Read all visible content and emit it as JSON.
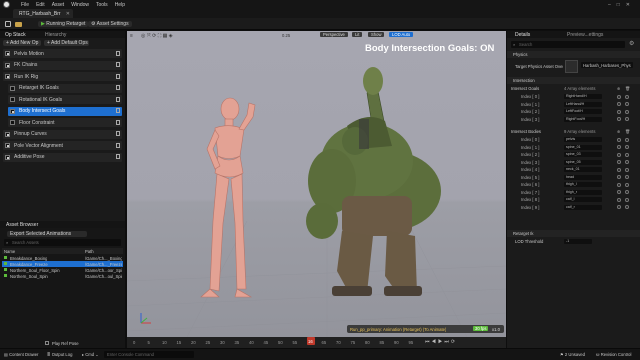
{
  "app": {
    "menu": [
      "File",
      "Edit",
      "Asset",
      "Window",
      "Tools",
      "Help"
    ],
    "tab_title": "RTG_Harbash_Brr",
    "toolbar": {
      "run_retarget": "Running Retarget",
      "asset_settings": "Asset Settings"
    }
  },
  "left": {
    "tabs": [
      "Op Stack",
      "Hierarchy"
    ],
    "add_new_op": "+ Add New Op",
    "add_default_ops": "+ Add Default Ops",
    "ops": [
      {
        "label": "Pelvis Motion",
        "checked": true,
        "sub": false,
        "selected": false
      },
      {
        "label": "FK Chains",
        "checked": true,
        "sub": false,
        "selected": false
      },
      {
        "label": "Run IK Rig",
        "checked": true,
        "sub": false,
        "selected": false
      },
      {
        "label": "Retarget IK Goals",
        "checked": false,
        "sub": true,
        "selected": false
      },
      {
        "label": "Rotational IK Goals",
        "checked": false,
        "sub": true,
        "selected": false
      },
      {
        "label": "Body Intersect Goals",
        "checked": true,
        "sub": true,
        "selected": true
      },
      {
        "label": "Floor Constraint",
        "checked": false,
        "sub": true,
        "selected": false
      },
      {
        "label": "Pinnup Curves",
        "checked": true,
        "sub": false,
        "selected": false
      },
      {
        "label": "Pole Vector Alignment",
        "checked": true,
        "sub": false,
        "selected": false
      },
      {
        "label": "Additive Pose",
        "checked": true,
        "sub": false,
        "selected": false
      }
    ],
    "asset_browser": {
      "title": "Asset Browser",
      "export_button": "Export Selected Animations",
      "search_placeholder": "Search Assets",
      "col_name": "Name",
      "col_path": "Path",
      "rows": [
        {
          "name": "Breakdance_Boxing",
          "path": "/Game/Ch..._Boxing"
        },
        {
          "name": "Breakdance_Freeze",
          "path": "/Game/Ch..._Freeze"
        },
        {
          "name": "Northern_Soul_Floor_Spin",
          "path": "/Game/Ch...oor_Spin"
        },
        {
          "name": "Northern_Soul_Spin",
          "path": "/Game/Ch...oul_Spin"
        }
      ],
      "play_ref_pose": "Play Ref Pose"
    }
  },
  "viewport": {
    "overlay_text": "Body Intersection Goals: ON",
    "perspective": "Perspective",
    "lit": "Lit",
    "show": "Show",
    "lod": "LOD Auto",
    "scale": "0.25",
    "bottom_hint": "Run_pp_primary: Animation (Retarget) (To Animate)",
    "speed": "x1.0",
    "fps": "30 fps"
  },
  "right": {
    "tabs": [
      "Details",
      "Preview...ettings"
    ],
    "search_placeholder": "Search",
    "physics_label": "Physics",
    "target_physics_label": "Target Physics Asset Override",
    "target_physics_value": "Harbash_Harbases_Physic",
    "intersection_label": "Intersection",
    "goals_label": "Intersect Goals",
    "goals_count": "4 Array elements",
    "goals": [
      {
        "index": "Index [ 0 ]",
        "value": "RightHand/H"
      },
      {
        "index": "Index [ 1 ]",
        "value": "LeftHand/H"
      },
      {
        "index": "Index [ 2 ]",
        "value": "LeftFoot/H"
      },
      {
        "index": "Index [ 3 ]",
        "value": "RightFoot/H"
      }
    ],
    "bodies_label": "Intersect Bodies",
    "bodies_count": "9 Array elements",
    "bodies": [
      {
        "index": "Index [ 0 ]",
        "value": "pelvis"
      },
      {
        "index": "Index [ 1 ]",
        "value": "spine_01"
      },
      {
        "index": "Index [ 2 ]",
        "value": "spine_03"
      },
      {
        "index": "Index [ 3 ]",
        "value": "spine_05"
      },
      {
        "index": "Index [ 4 ]",
        "value": "neck_01"
      },
      {
        "index": "Index [ 5 ]",
        "value": "head"
      },
      {
        "index": "Index [ 6 ]",
        "value": "thigh_l"
      },
      {
        "index": "Index [ 7 ]",
        "value": "thigh_r"
      },
      {
        "index": "Index [ 8 ]",
        "value": "calf_l"
      },
      {
        "index": "Index [ 9 ]",
        "value": "calf_r"
      }
    ],
    "retarget_label": "Retarget Ik",
    "lod_threshold_label": "LOD Threshold",
    "lod_threshold_value": "-1"
  },
  "timeline": {
    "ticks": [
      "0",
      "5",
      "10",
      "15",
      "20",
      "25",
      "30",
      "35",
      "40",
      "45",
      "50",
      "55",
      "60",
      "65",
      "70",
      "75",
      "80",
      "85",
      "90",
      "95"
    ],
    "current_frame": "16"
  },
  "status": {
    "content_drawer": "Content Drawer",
    "output_log": "Output Log",
    "cmd": "Cmd",
    "console_placeholder": "Enter Console Command",
    "unsaved": "2 Unsaved",
    "revision_control": "Revision Control"
  },
  "colors": {
    "accent": "#1e6fd0",
    "green": "#5cbb3b",
    "viewport_bg": "#a4a4ae",
    "overlay_text": "#ffffff"
  },
  "icons": [
    "unreal-logo-icon",
    "save-icon",
    "play-icon",
    "gear-icon",
    "search-icon",
    "trash-icon",
    "lock-icon",
    "reset-arrow-icon"
  ]
}
